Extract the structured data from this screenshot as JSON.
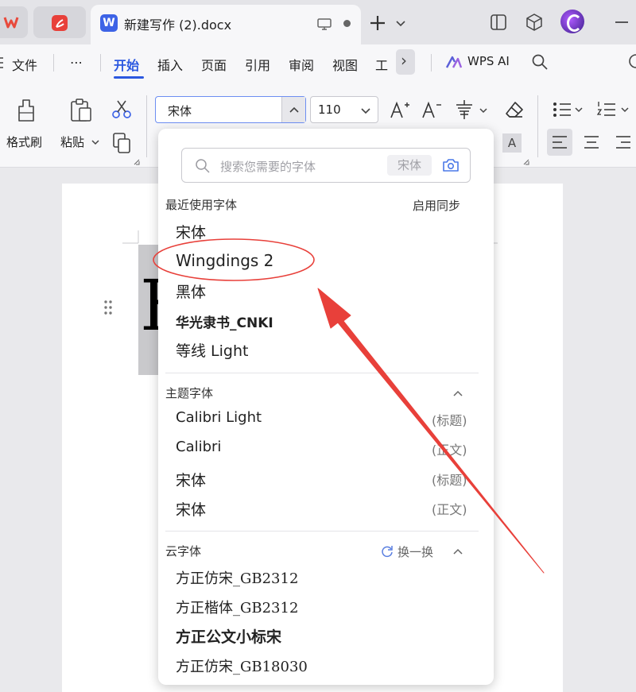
{
  "titlebar": {
    "doc_tab_title": "新建写作 (2).docx",
    "w_logo": "W",
    "avatar_letter": "C"
  },
  "menubar": {
    "items": [
      "文件",
      "⋯",
      "开始",
      "插入",
      "页面",
      "引用",
      "审阅",
      "视图",
      "工"
    ],
    "more": "›",
    "wps_ai": "WPS AI"
  },
  "ribbon": {
    "format_painter": "格式刷",
    "paste": "粘贴",
    "font_name": "宋体",
    "font_size": "110"
  },
  "dropdown": {
    "search_placeholder": "搜索您需要的字体",
    "search_tag": "宋体",
    "recent": {
      "title": "最近使用字体",
      "sync": "启用同步",
      "fonts": [
        "宋体",
        "Wingdings 2",
        "黑体",
        "华光隶书_CNKI",
        "等线 Light"
      ]
    },
    "theme": {
      "title": "主题字体",
      "fonts": [
        {
          "name": "Calibri Light",
          "tag": "(标题)"
        },
        {
          "name": "Calibri",
          "tag": "(正文)"
        },
        {
          "name": "宋体",
          "tag": "(标题)"
        },
        {
          "name": "宋体",
          "tag": "(正文)"
        }
      ]
    },
    "cloud": {
      "title": "云字体",
      "refresh": "换一换",
      "fonts": [
        "方正仿宋_GB2312",
        "方正楷体_GB2312",
        "方正公文小标宋",
        "方正仿宋_GB18030"
      ]
    }
  },
  "colors": {
    "accent": "#2b58e0",
    "annotation": "#e8403a"
  }
}
